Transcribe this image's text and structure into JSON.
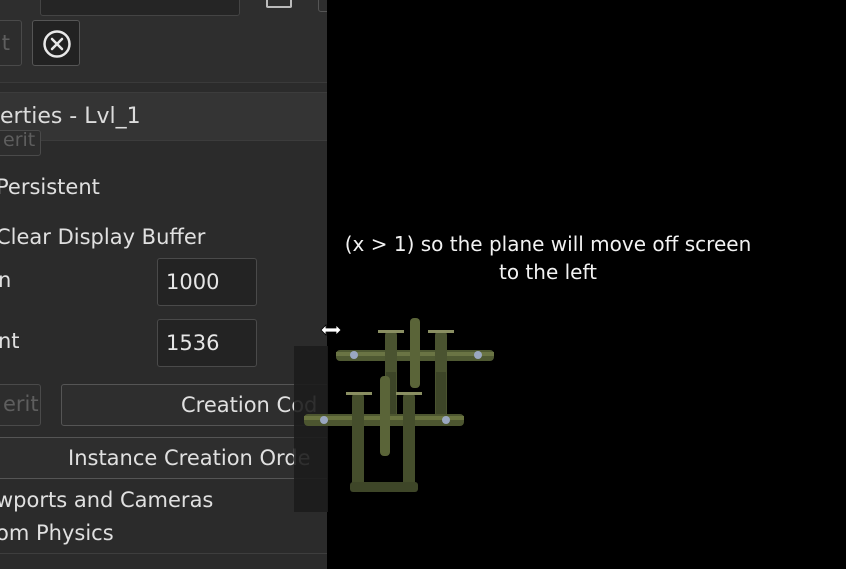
{
  "panel": {
    "inherit_partial_top": "t",
    "section_title": "erties - Lvl_1",
    "inherit_partial_under_header": "erit",
    "persistent_label": "Persistent",
    "clear_display_label": "Clear Display Buffer",
    "width_label_partial": "n",
    "width_value": "1000",
    "height_label_partial": "nt",
    "height_value": "1536",
    "inherit_partial_bottom": "erit",
    "creation_code_label": "Creation Cod",
    "instance_order_label": "Instance Creation Orde",
    "viewports_label": "wports and Cameras",
    "physics_label": "om Physics"
  },
  "game_view": {
    "caption_line1": "(x > 1) so the plane will move off screen",
    "caption_line2": "to the left"
  },
  "icons": {
    "close": "close-circle-icon",
    "resize": "horizontal-resize-cursor-icon",
    "sprite": "fighter-plane-sprite"
  },
  "colors": {
    "panel_bg": "#2b2b2b",
    "game_bg": "#000000",
    "text": "#e0e0e0",
    "plane_olive": "#4d5630"
  }
}
